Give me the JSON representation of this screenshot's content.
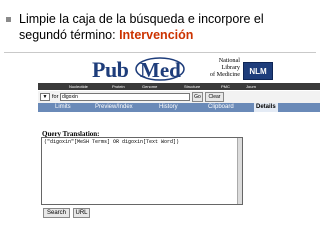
{
  "slide": {
    "title_text": "Limpie la caja de la búsqueda e incorpore el segundó término: ",
    "title_highlight": "Intervención"
  },
  "pubmed": {
    "logo_pub": "Pub",
    "logo_med": "Med",
    "nlm_lines": [
      "National",
      "Library",
      "of Medicine"
    ],
    "nlm_badge": "NLM",
    "top_nav": [
      "Nucleotide",
      "Protein",
      "Genome",
      "Structure",
      "PMC",
      "Journ"
    ],
    "search": {
      "select_value": "▼",
      "for_label": "for",
      "input_value": "digoxin",
      "go_label": "Go",
      "clear_label": "Clear"
    },
    "tabs": [
      "Limits",
      "Preview/Index",
      "History",
      "Clipboard",
      "Details"
    ],
    "active_tab": "Details",
    "query_translation": {
      "label": "Query Translation:",
      "text": "(\"digoxin\"[MeSH Terms] OR digoxin[Text Word])"
    },
    "buttons": {
      "search_label": "Search",
      "url_label": "URL"
    }
  },
  "colors": {
    "highlight": "#cc3300",
    "pubmed_blue": "#1e3d7b",
    "tab_bar": "#6a8ab8",
    "nav_band": "#3a3a3a"
  }
}
